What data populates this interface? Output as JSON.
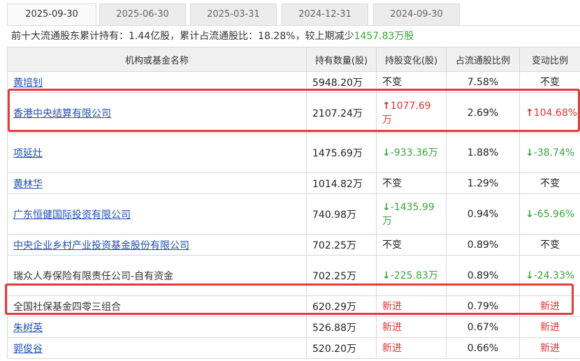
{
  "tabs": [
    "2025-09-30",
    "2025-06-30",
    "2025-03-31",
    "2024-12-31",
    "2024-09-30"
  ],
  "summary": {
    "prefix": "前十大流通股东累计持有：",
    "held": "1.44亿股",
    "mid": "，累计占流通股比：",
    "ratio": "18.28%",
    "suffix": "，较上期减少",
    "change": "1457.83万股"
  },
  "columns": [
    "机构或基金名称",
    "持有数量(股)",
    "持股变化(股)",
    "占流通股比例",
    "变动比例"
  ],
  "rows": [
    {
      "name": "黄培钊",
      "link": true,
      "qty": "5948.20万",
      "chg_dir": "same",
      "chg": "不变",
      "ratio": "7.58%",
      "pct_dir": "same",
      "pct": "不变"
    },
    {
      "name": "香港中央结算有限公司",
      "link": true,
      "qty": "2107.24万",
      "chg_dir": "up",
      "chg": "1077.69万",
      "ratio": "2.69%",
      "pct_dir": "up",
      "pct": "104.68%"
    },
    {
      "name": "项延灶",
      "link": true,
      "qty": "1475.69万",
      "chg_dir": "down",
      "chg": "-933.36万",
      "ratio": "1.88%",
      "pct_dir": "down",
      "pct": "-38.74%"
    },
    {
      "name": "黄林华",
      "link": true,
      "qty": "1014.82万",
      "chg_dir": "same",
      "chg": "不变",
      "ratio": "1.29%",
      "pct_dir": "same",
      "pct": "不变"
    },
    {
      "name": "广东恒健国际投资有限公司",
      "link": true,
      "qty": "740.98万",
      "chg_dir": "down",
      "chg": "-1435.99万",
      "ratio": "0.94%",
      "pct_dir": "down",
      "pct": "-65.96%"
    },
    {
      "name": "中央企业乡村产业投资基金股份有限公司",
      "link": true,
      "qty": "702.25万",
      "chg_dir": "same",
      "chg": "不变",
      "ratio": "0.89%",
      "pct_dir": "same",
      "pct": "不变"
    },
    {
      "name": "瑞众人寿保险有限责任公司-自有资金",
      "link": false,
      "qty": "702.25万",
      "chg_dir": "down",
      "chg": "-225.83万",
      "ratio": "0.89%",
      "pct_dir": "down",
      "pct": "-24.33%"
    },
    {
      "name": "全国社保基金四零三组合",
      "link": false,
      "qty": "620.29万",
      "chg_dir": "new",
      "chg": "新进",
      "ratio": "0.79%",
      "pct_dir": "new",
      "pct": "新进"
    },
    {
      "name": "朱树英",
      "link": true,
      "qty": "526.88万",
      "chg_dir": "new",
      "chg": "新进",
      "ratio": "0.67%",
      "pct_dir": "new",
      "pct": "新进"
    },
    {
      "name": "郭俊谷",
      "link": true,
      "qty": "520.20万",
      "chg_dir": "new",
      "chg": "新进",
      "ratio": "0.66%",
      "pct_dir": "new",
      "pct": "新进"
    }
  ],
  "highlighted_rows": [
    1,
    7
  ],
  "colors": {
    "up": "#dd3333",
    "down": "#3aa53a",
    "link": "#1d4fb3",
    "highlight": "#e03c3c"
  }
}
